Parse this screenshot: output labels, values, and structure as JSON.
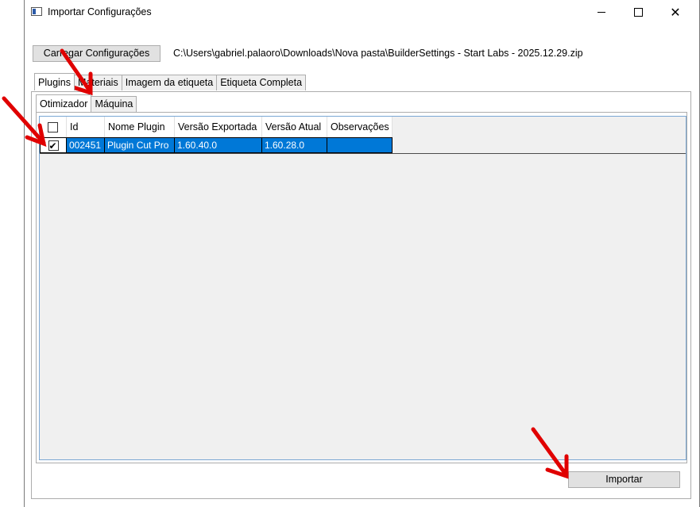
{
  "window": {
    "title": "Importar Configurações"
  },
  "toolbar": {
    "load_button": "Carregar Configurações",
    "file_path": "C:\\Users\\gabriel.palaoro\\Downloads\\Nova pasta\\BuilderSettings - Start Labs - 2025.12.29.zip"
  },
  "tabs": [
    {
      "label": "Plugins",
      "active": true
    },
    {
      "label": "Materiais",
      "active": false
    },
    {
      "label": "Imagem da etiqueta",
      "active": false
    },
    {
      "label": "Etiqueta Completa",
      "active": false
    }
  ],
  "subtabs": [
    {
      "label": "Otimizador",
      "active": true
    },
    {
      "label": "Máquina",
      "active": false
    }
  ],
  "grid": {
    "columns": [
      "Id",
      "Nome Plugin",
      "Versão Exportada",
      "Versão Atual",
      "Observações"
    ],
    "rows": [
      {
        "checked": true,
        "id": "002451",
        "name": "Plugin Cut Pro",
        "exported": "1.60.40.0",
        "current": "1.60.28.0",
        "notes": ""
      }
    ]
  },
  "footer": {
    "import_button": "Importar"
  },
  "colors": {
    "selection": "#0078d7",
    "annotation_arrow": "#e00000"
  }
}
